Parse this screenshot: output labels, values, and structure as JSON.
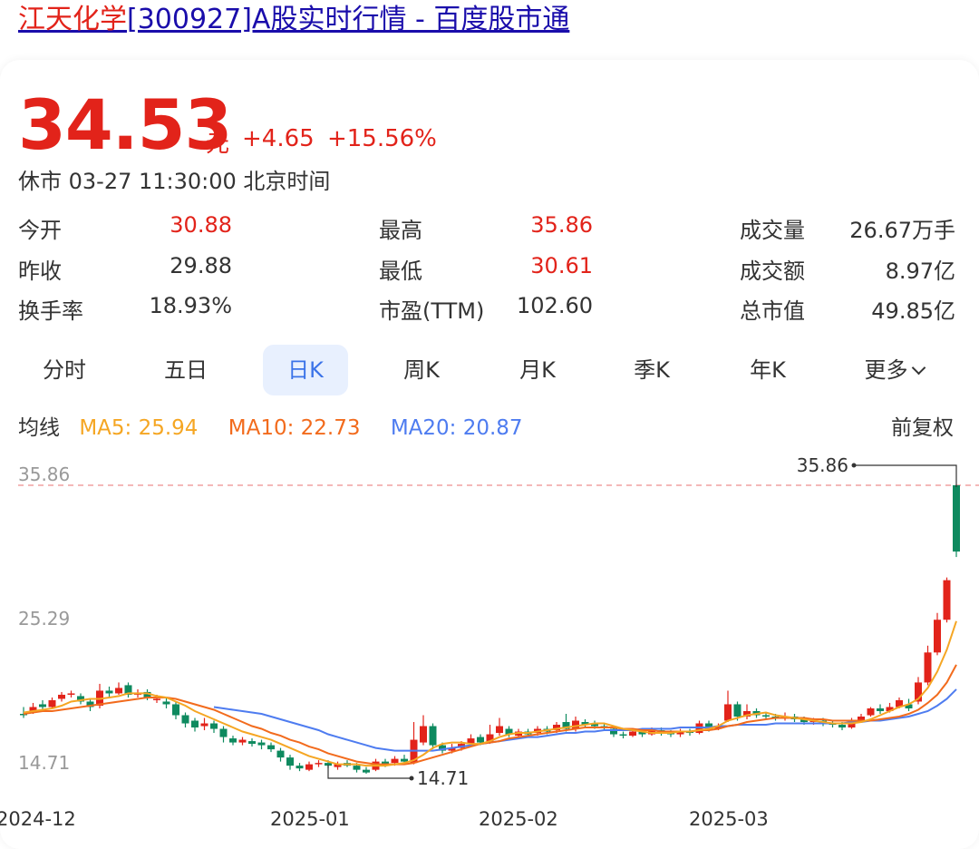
{
  "page_title": {
    "name": "江天化学",
    "rest": "[300927]A股实时行情 - 百度股市通"
  },
  "quote": {
    "price": "34.53",
    "unit": "元",
    "change": "+4.65",
    "change_pct": "+15.56%",
    "status": "休市 03-27 11:30:00 北京时间"
  },
  "stats": [
    {
      "label": "今开",
      "value": "30.88",
      "color": "red"
    },
    {
      "label": "最高",
      "value": "35.86",
      "color": "red"
    },
    {
      "label": "成交量",
      "value": "26.67万手",
      "color": "dark"
    },
    {
      "label": "昨收",
      "value": "29.88",
      "color": "dark"
    },
    {
      "label": "最低",
      "value": "30.61",
      "color": "red"
    },
    {
      "label": "成交额",
      "value": "8.97亿",
      "color": "dark"
    },
    {
      "label": "换手率",
      "value": "18.93%",
      "color": "dark"
    },
    {
      "label": "市盈(TTM)",
      "value": "102.60",
      "color": "dark"
    },
    {
      "label": "总市值",
      "value": "49.85亿",
      "color": "dark"
    }
  ],
  "tabs": [
    {
      "label": "分时",
      "active": false
    },
    {
      "label": "五日",
      "active": false
    },
    {
      "label": "日K",
      "active": true
    },
    {
      "label": "周K",
      "active": false
    },
    {
      "label": "月K",
      "active": false
    },
    {
      "label": "季K",
      "active": false
    },
    {
      "label": "年K",
      "active": false
    },
    {
      "label": "更多",
      "active": false
    }
  ],
  "ma": {
    "label": "均线",
    "ma5": "MA5: 25.94",
    "ma10": "MA10: 22.73",
    "ma20": "MA20: 20.87",
    "fuquan": "前复权"
  },
  "colors": {
    "up": "#e2231a",
    "down": "#0e8a5f",
    "ma5": "#f5a623",
    "ma10": "#f26b1d",
    "ma20": "#4e7cf0",
    "active_tab": "#3b73e8"
  },
  "chart_data": {
    "type": "candlestick",
    "y_ticks": [
      "35.86",
      "25.29",
      "14.71"
    ],
    "ylim": [
      14.71,
      35.86
    ],
    "x_ticks": [
      "2024-12",
      "2025-01",
      "2025-02",
      "2025-03"
    ],
    "max_label": "35.86",
    "min_label": "14.71",
    "candles": [
      [
        19.1,
        19.0,
        19.6,
        18.8
      ],
      [
        19.3,
        19.6,
        19.9,
        19.1
      ],
      [
        19.8,
        19.6,
        20.1,
        19.4
      ],
      [
        19.6,
        20.1,
        20.3,
        19.5
      ],
      [
        20.2,
        20.5,
        20.7,
        20.0
      ],
      [
        20.5,
        20.6,
        20.8,
        20.3
      ],
      [
        20.4,
        20.0,
        20.6,
        19.8
      ],
      [
        20.0,
        19.6,
        20.2,
        19.3
      ],
      [
        19.7,
        20.8,
        21.3,
        19.5
      ],
      [
        20.8,
        20.6,
        21.1,
        20.3
      ],
      [
        20.6,
        21.0,
        21.4,
        20.5
      ],
      [
        21.2,
        20.5,
        21.4,
        20.3
      ],
      [
        20.5,
        20.6,
        20.9,
        20.3
      ],
      [
        20.7,
        20.3,
        20.9,
        20.1
      ],
      [
        20.2,
        20.2,
        20.5,
        19.9
      ],
      [
        20.0,
        19.8,
        20.3,
        19.5
      ],
      [
        19.8,
        19.0,
        20.0,
        18.7
      ],
      [
        19.0,
        18.4,
        19.2,
        18.1
      ],
      [
        18.6,
        18.1,
        18.8,
        17.8
      ],
      [
        18.2,
        18.4,
        18.8,
        17.9
      ],
      [
        18.4,
        18.0,
        18.6,
        17.7
      ],
      [
        18.0,
        17.4,
        18.2,
        17.0
      ],
      [
        17.3,
        17.0,
        17.5,
        16.8
      ],
      [
        17.0,
        17.2,
        17.4,
        16.8
      ],
      [
        17.1,
        16.9,
        17.3,
        16.7
      ],
      [
        17.0,
        16.8,
        17.2,
        16.5
      ],
      [
        16.8,
        16.5,
        17.0,
        16.3
      ],
      [
        16.4,
        15.9,
        16.6,
        15.6
      ],
      [
        15.9,
        15.3,
        16.1,
        15.0
      ],
      [
        15.3,
        15.1,
        15.5,
        14.9
      ],
      [
        15.0,
        15.4,
        15.6,
        14.9
      ],
      [
        15.5,
        15.5,
        15.7,
        15.2
      ],
      [
        15.5,
        15.3,
        15.7,
        15.1
      ],
      [
        15.2,
        15.4,
        15.6,
        15.0
      ],
      [
        15.5,
        15.3,
        15.7,
        15.2
      ],
      [
        15.3,
        15.0,
        15.5,
        14.8
      ],
      [
        15.0,
        14.8,
        15.2,
        14.71
      ],
      [
        15.0,
        15.6,
        15.8,
        14.9
      ],
      [
        15.6,
        15.4,
        15.8,
        15.2
      ],
      [
        15.5,
        15.8,
        16.0,
        15.3
      ],
      [
        15.8,
        15.6,
        16.1,
        15.4
      ],
      [
        15.5,
        17.2,
        18.5,
        15.4
      ],
      [
        17.0,
        18.2,
        19.0,
        16.8
      ],
      [
        18.2,
        16.8,
        18.4,
        16.5
      ],
      [
        16.8,
        16.4,
        17.0,
        16.2
      ],
      [
        16.4,
        16.6,
        16.9,
        16.2
      ],
      [
        16.6,
        16.9,
        17.1,
        16.4
      ],
      [
        16.9,
        17.3,
        17.6,
        16.7
      ],
      [
        17.4,
        17.0,
        17.6,
        16.8
      ],
      [
        17.0,
        17.6,
        18.3,
        16.9
      ],
      [
        17.7,
        18.2,
        18.8,
        17.5
      ],
      [
        18.0,
        17.6,
        18.2,
        17.4
      ],
      [
        17.5,
        17.8,
        18.0,
        17.3
      ],
      [
        17.8,
        17.6,
        18.0,
        17.4
      ],
      [
        17.7,
        18.0,
        18.2,
        17.5
      ],
      [
        18.0,
        17.8,
        18.2,
        17.6
      ],
      [
        17.9,
        18.3,
        18.5,
        17.7
      ],
      [
        18.5,
        18.0,
        19.1,
        17.8
      ],
      [
        18.0,
        18.6,
        18.9,
        17.8
      ],
      [
        18.5,
        18.3,
        18.7,
        18.1
      ],
      [
        18.4,
        18.2,
        18.6,
        18.0
      ],
      [
        18.2,
        18.1,
        18.4,
        17.9
      ],
      [
        18.0,
        17.6,
        18.2,
        17.4
      ],
      [
        17.6,
        17.5,
        17.8,
        17.3
      ],
      [
        17.5,
        17.8,
        18.0,
        17.4
      ],
      [
        17.8,
        17.6,
        18.0,
        17.4
      ],
      [
        17.6,
        17.9,
        18.1,
        17.5
      ],
      [
        17.9,
        17.7,
        18.1,
        17.5
      ],
      [
        17.7,
        17.6,
        17.9,
        17.4
      ],
      [
        17.6,
        17.8,
        18.0,
        17.4
      ],
      [
        17.8,
        17.7,
        18.0,
        17.5
      ],
      [
        17.7,
        18.4,
        18.6,
        17.6
      ],
      [
        18.4,
        18.0,
        18.6,
        17.8
      ],
      [
        18.0,
        18.2,
        18.4,
        17.9
      ],
      [
        18.6,
        19.8,
        20.8,
        18.5
      ],
      [
        19.8,
        18.9,
        20.0,
        18.6
      ],
      [
        18.9,
        19.3,
        19.8,
        18.7
      ],
      [
        19.3,
        19.0,
        19.5,
        18.8
      ],
      [
        19.0,
        18.9,
        19.2,
        18.7
      ],
      [
        18.9,
        18.8,
        19.1,
        18.6
      ],
      [
        18.8,
        18.9,
        19.2,
        18.6
      ],
      [
        18.9,
        18.7,
        19.1,
        18.5
      ],
      [
        18.7,
        18.5,
        18.9,
        18.3
      ],
      [
        18.5,
        18.6,
        18.8,
        18.3
      ],
      [
        18.6,
        18.4,
        18.8,
        18.2
      ],
      [
        18.4,
        18.3,
        18.6,
        18.1
      ],
      [
        18.3,
        18.1,
        18.5,
        17.9
      ],
      [
        18.1,
        18.6,
        18.8,
        18.0
      ],
      [
        18.6,
        18.9,
        19.1,
        18.5
      ],
      [
        19.0,
        19.5,
        19.6,
        18.9
      ],
      [
        19.5,
        19.3,
        19.8,
        19.1
      ],
      [
        19.3,
        19.6,
        19.9,
        19.2
      ],
      [
        19.6,
        20.1,
        20.3,
        19.5
      ],
      [
        19.8,
        19.5,
        20.2,
        19.3
      ],
      [
        20.0,
        21.4,
        21.8,
        19.8
      ],
      [
        21.4,
        23.6,
        24.1,
        21.2
      ],
      [
        23.6,
        26.0,
        26.5,
        23.4
      ],
      [
        26.0,
        28.9,
        29.1,
        25.8
      ],
      [
        35.86,
        31.0,
        35.86,
        30.6
      ]
    ],
    "ma5": [
      19.2,
      19.3,
      19.4,
      19.5,
      19.7,
      20.0,
      20.1,
      20.2,
      20.2,
      20.3,
      20.4,
      20.6,
      20.6,
      20.6,
      20.4,
      20.3,
      20.0,
      19.7,
      19.3,
      19.0,
      18.7,
      18.4,
      18.1,
      17.8,
      17.6,
      17.4,
      17.2,
      16.9,
      16.6,
      16.3,
      16.0,
      15.8,
      15.6,
      15.4,
      15.4,
      15.4,
      15.3,
      15.3,
      15.3,
      15.4,
      15.5,
      15.7,
      16.1,
      16.6,
      16.9,
      17.0,
      17.0,
      16.9,
      16.9,
      17.1,
      17.4,
      17.6,
      17.7,
      17.7,
      17.8,
      17.9,
      18.0,
      18.1,
      18.2,
      18.3,
      18.4,
      18.4,
      18.2,
      18.0,
      17.9,
      17.8,
      17.7,
      17.7,
      17.7,
      17.8,
      17.8,
      17.9,
      18.0,
      18.2,
      18.6,
      18.8,
      19.0,
      19.1,
      19.2,
      19.0,
      18.9,
      18.8,
      18.7,
      18.6,
      18.5,
      18.4,
      18.4,
      18.4,
      18.5,
      18.7,
      19.0,
      19.3,
      19.6,
      19.8,
      20.2,
      21.0,
      22.2,
      23.8,
      25.9
    ],
    "ma10": [
      19.1,
      19.2,
      19.3,
      19.3,
      19.4,
      19.5,
      19.6,
      19.7,
      19.8,
      19.9,
      20.0,
      20.1,
      20.2,
      20.3,
      20.3,
      20.3,
      20.2,
      20.0,
      19.8,
      19.6,
      19.4,
      19.1,
      18.8,
      18.5,
      18.2,
      18.0,
      17.7,
      17.5,
      17.2,
      17.0,
      16.7,
      16.5,
      16.2,
      16.0,
      15.8,
      15.6,
      15.5,
      15.4,
      15.4,
      15.4,
      15.4,
      15.5,
      15.7,
      15.9,
      16.1,
      16.3,
      16.5,
      16.7,
      16.9,
      17.0,
      17.1,
      17.3,
      17.4,
      17.5,
      17.6,
      17.7,
      17.8,
      17.9,
      18.0,
      18.1,
      18.1,
      18.1,
      18.1,
      18.0,
      18.0,
      17.9,
      17.9,
      17.8,
      17.8,
      17.8,
      17.8,
      17.9,
      17.9,
      18.0,
      18.2,
      18.3,
      18.5,
      18.6,
      18.7,
      18.8,
      18.8,
      18.8,
      18.8,
      18.7,
      18.7,
      18.6,
      18.6,
      18.6,
      18.6,
      18.6,
      18.7,
      18.8,
      18.9,
      19.1,
      19.4,
      19.9,
      20.5,
      21.4,
      22.7
    ],
    "ma20": [
      null,
      null,
      null,
      null,
      null,
      null,
      null,
      null,
      null,
      null,
      null,
      null,
      null,
      null,
      null,
      null,
      null,
      null,
      null,
      null,
      19.6,
      19.5,
      19.4,
      19.3,
      19.2,
      19.1,
      18.9,
      18.7,
      18.5,
      18.3,
      18.1,
      17.9,
      17.6,
      17.4,
      17.2,
      17.0,
      16.8,
      16.6,
      16.5,
      16.4,
      16.4,
      16.4,
      16.4,
      16.4,
      16.5,
      16.6,
      16.7,
      16.8,
      16.9,
      17.0,
      17.1,
      17.2,
      17.3,
      17.4,
      17.4,
      17.5,
      17.6,
      17.7,
      17.7,
      17.8,
      17.8,
      17.9,
      17.9,
      17.9,
      17.9,
      18.0,
      18.0,
      18.0,
      18.0,
      18.1,
      18.1,
      18.1,
      18.1,
      18.2,
      18.2,
      18.3,
      18.3,
      18.3,
      18.3,
      18.4,
      18.4,
      18.4,
      18.4,
      18.4,
      18.4,
      18.4,
      18.4,
      18.5,
      18.5,
      18.6,
      18.6,
      18.7,
      18.8,
      18.9,
      19.1,
      19.3,
      19.7,
      20.2,
      20.9
    ]
  }
}
